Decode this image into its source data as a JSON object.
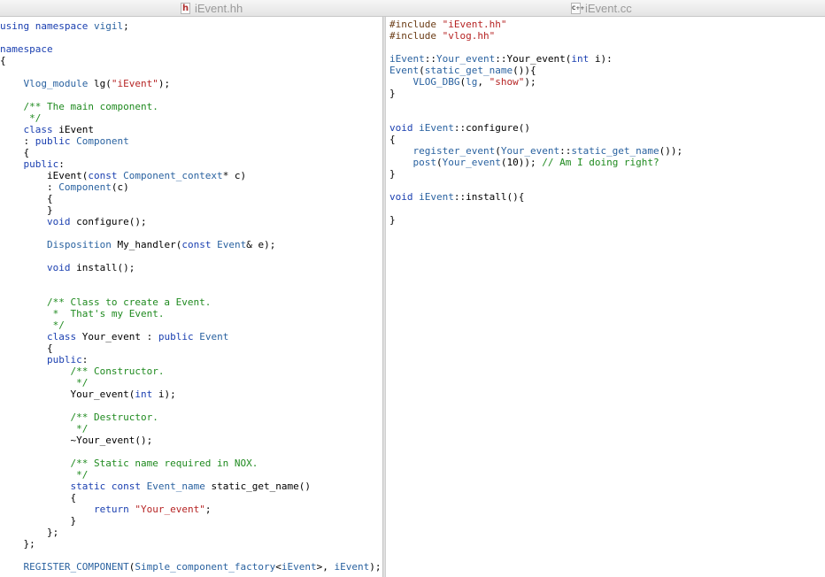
{
  "window": {
    "tabs": [
      {
        "title": "iEvent.hh",
        "icon": "h-file-icon"
      },
      {
        "title": "iEvent.cc",
        "icon": "cpp-file-icon"
      }
    ]
  },
  "colors": {
    "keyword": "#1a3fb0",
    "type": "#2a62a0",
    "string": "#b62424",
    "comment": "#1f8a1f",
    "preprocessor": "#6a3b14",
    "plain": "#000000"
  },
  "editors": {
    "left": {
      "file": "iEvent.hh",
      "lines": [
        [
          [
            "kw",
            "using namespace "
          ],
          [
            "ty",
            "vigil"
          ],
          [
            "p",
            ";"
          ]
        ],
        [],
        [
          [
            "kw",
            "namespace"
          ]
        ],
        [
          [
            "p",
            "{"
          ]
        ],
        [],
        [
          [
            "p",
            "    "
          ],
          [
            "ty",
            "Vlog_module"
          ],
          [
            "p",
            " lg("
          ],
          [
            "str",
            "\"iEvent\""
          ],
          [
            "p",
            ");"
          ]
        ],
        [],
        [
          [
            "p",
            "    "
          ],
          [
            "cm",
            "/** The main component."
          ]
        ],
        [
          [
            "p",
            "    "
          ],
          [
            "cm",
            " */"
          ]
        ],
        [
          [
            "p",
            "    "
          ],
          [
            "kw",
            "class"
          ],
          [
            "p",
            " iEvent"
          ]
        ],
        [
          [
            "p",
            "    : "
          ],
          [
            "kw",
            "public"
          ],
          [
            "p",
            " "
          ],
          [
            "ty",
            "Component"
          ]
        ],
        [
          [
            "p",
            "    {"
          ]
        ],
        [
          [
            "p",
            "    "
          ],
          [
            "kw",
            "public"
          ],
          [
            "p",
            ":"
          ]
        ],
        [
          [
            "p",
            "        iEvent("
          ],
          [
            "kw",
            "const"
          ],
          [
            "p",
            " "
          ],
          [
            "ty",
            "Component_context"
          ],
          [
            "p",
            "* c)"
          ]
        ],
        [
          [
            "p",
            "        : "
          ],
          [
            "ty",
            "Component"
          ],
          [
            "p",
            "(c)"
          ]
        ],
        [
          [
            "p",
            "        {"
          ]
        ],
        [
          [
            "p",
            "        }"
          ]
        ],
        [
          [
            "p",
            "        "
          ],
          [
            "kw",
            "void"
          ],
          [
            "p",
            " configure();"
          ]
        ],
        [],
        [
          [
            "p",
            "        "
          ],
          [
            "ty",
            "Disposition"
          ],
          [
            "p",
            " My_handler("
          ],
          [
            "kw",
            "const"
          ],
          [
            "p",
            " "
          ],
          [
            "ty",
            "Event"
          ],
          [
            "p",
            "& e);"
          ]
        ],
        [],
        [
          [
            "p",
            "        "
          ],
          [
            "kw",
            "void"
          ],
          [
            "p",
            " install();"
          ]
        ],
        [],
        [],
        [
          [
            "p",
            "        "
          ],
          [
            "cm",
            "/** Class to create a Event."
          ]
        ],
        [
          [
            "p",
            "        "
          ],
          [
            "cm",
            " *  That's my Event."
          ]
        ],
        [
          [
            "p",
            "        "
          ],
          [
            "cm",
            " */"
          ]
        ],
        [
          [
            "p",
            "        "
          ],
          [
            "kw",
            "class"
          ],
          [
            "p",
            " Your_event : "
          ],
          [
            "kw",
            "public"
          ],
          [
            "p",
            " "
          ],
          [
            "ty",
            "Event"
          ]
        ],
        [
          [
            "p",
            "        {"
          ]
        ],
        [
          [
            "p",
            "        "
          ],
          [
            "kw",
            "public"
          ],
          [
            "p",
            ":"
          ]
        ],
        [
          [
            "p",
            "            "
          ],
          [
            "cm",
            "/** Constructor."
          ]
        ],
        [
          [
            "p",
            "            "
          ],
          [
            "cm",
            " */"
          ]
        ],
        [
          [
            "p",
            "            Your_event("
          ],
          [
            "kw",
            "int"
          ],
          [
            "p",
            " i);"
          ]
        ],
        [],
        [
          [
            "p",
            "            "
          ],
          [
            "cm",
            "/** Destructor."
          ]
        ],
        [
          [
            "p",
            "            "
          ],
          [
            "cm",
            " */"
          ]
        ],
        [
          [
            "p",
            "            ~Your_event();"
          ]
        ],
        [],
        [
          [
            "p",
            "            "
          ],
          [
            "cm",
            "/** Static name required in NOX."
          ]
        ],
        [
          [
            "p",
            "            "
          ],
          [
            "cm",
            " */"
          ]
        ],
        [
          [
            "p",
            "            "
          ],
          [
            "kw",
            "static const"
          ],
          [
            "p",
            " "
          ],
          [
            "ty",
            "Event_name"
          ],
          [
            "p",
            " static_get_name()"
          ]
        ],
        [
          [
            "p",
            "            {"
          ]
        ],
        [
          [
            "p",
            "                "
          ],
          [
            "kw",
            "return"
          ],
          [
            "p",
            " "
          ],
          [
            "str",
            "\"Your_event\""
          ],
          [
            "p",
            ";"
          ]
        ],
        [
          [
            "p",
            "            }"
          ]
        ],
        [
          [
            "p",
            "        };"
          ]
        ],
        [
          [
            "p",
            "    };"
          ]
        ],
        [],
        [
          [
            "p",
            "    "
          ],
          [
            "ty",
            "REGISTER_COMPONENT"
          ],
          [
            "p",
            "("
          ],
          [
            "ty",
            "Simple_component_factory"
          ],
          [
            "p",
            "<"
          ],
          [
            "ty",
            "iEvent"
          ],
          [
            "p",
            ">, "
          ],
          [
            "ty",
            "iEvent"
          ],
          [
            "p",
            ");"
          ]
        ]
      ]
    },
    "right": {
      "file": "iEvent.cc",
      "lines": [
        [
          [
            "pp",
            "#include "
          ],
          [
            "str",
            "\"iEvent.hh\""
          ]
        ],
        [
          [
            "pp",
            "#include "
          ],
          [
            "str",
            "\"vlog.hh\""
          ]
        ],
        [],
        [
          [
            "ty",
            "iEvent"
          ],
          [
            "p",
            "::"
          ],
          [
            "ty",
            "Your_event"
          ],
          [
            "p",
            "::Your_event("
          ],
          [
            "kw",
            "int"
          ],
          [
            "p",
            " i):"
          ]
        ],
        [
          [
            "ty",
            "Event"
          ],
          [
            "p",
            "("
          ],
          [
            "ty",
            "static_get_name"
          ],
          [
            "p",
            "()){"
          ]
        ],
        [
          [
            "p",
            "    "
          ],
          [
            "ty",
            "VLOG_DBG"
          ],
          [
            "p",
            "("
          ],
          [
            "ty",
            "lg"
          ],
          [
            "p",
            ", "
          ],
          [
            "str",
            "\"show\""
          ],
          [
            "p",
            ");"
          ]
        ],
        [
          [
            "p",
            "}"
          ]
        ],
        [],
        [],
        [
          [
            "kw",
            "void"
          ],
          [
            "p",
            " "
          ],
          [
            "ty",
            "iEvent"
          ],
          [
            "p",
            "::configure()"
          ]
        ],
        [
          [
            "p",
            "{"
          ]
        ],
        [
          [
            "p",
            "    "
          ],
          [
            "ty",
            "register_event"
          ],
          [
            "p",
            "("
          ],
          [
            "ty",
            "Your_event"
          ],
          [
            "p",
            "::"
          ],
          [
            "ty",
            "static_get_name"
          ],
          [
            "p",
            "());"
          ]
        ],
        [
          [
            "p",
            "    "
          ],
          [
            "ty",
            "post"
          ],
          [
            "p",
            "("
          ],
          [
            "ty",
            "Your_event"
          ],
          [
            "p",
            "(10)); "
          ],
          [
            "cm",
            "// Am I doing right?"
          ]
        ],
        [
          [
            "p",
            "}"
          ]
        ],
        [],
        [
          [
            "kw",
            "void"
          ],
          [
            "p",
            " "
          ],
          [
            "ty",
            "iEvent"
          ],
          [
            "p",
            "::install(){"
          ]
        ],
        [],
        [
          [
            "p",
            "}"
          ]
        ]
      ]
    }
  }
}
